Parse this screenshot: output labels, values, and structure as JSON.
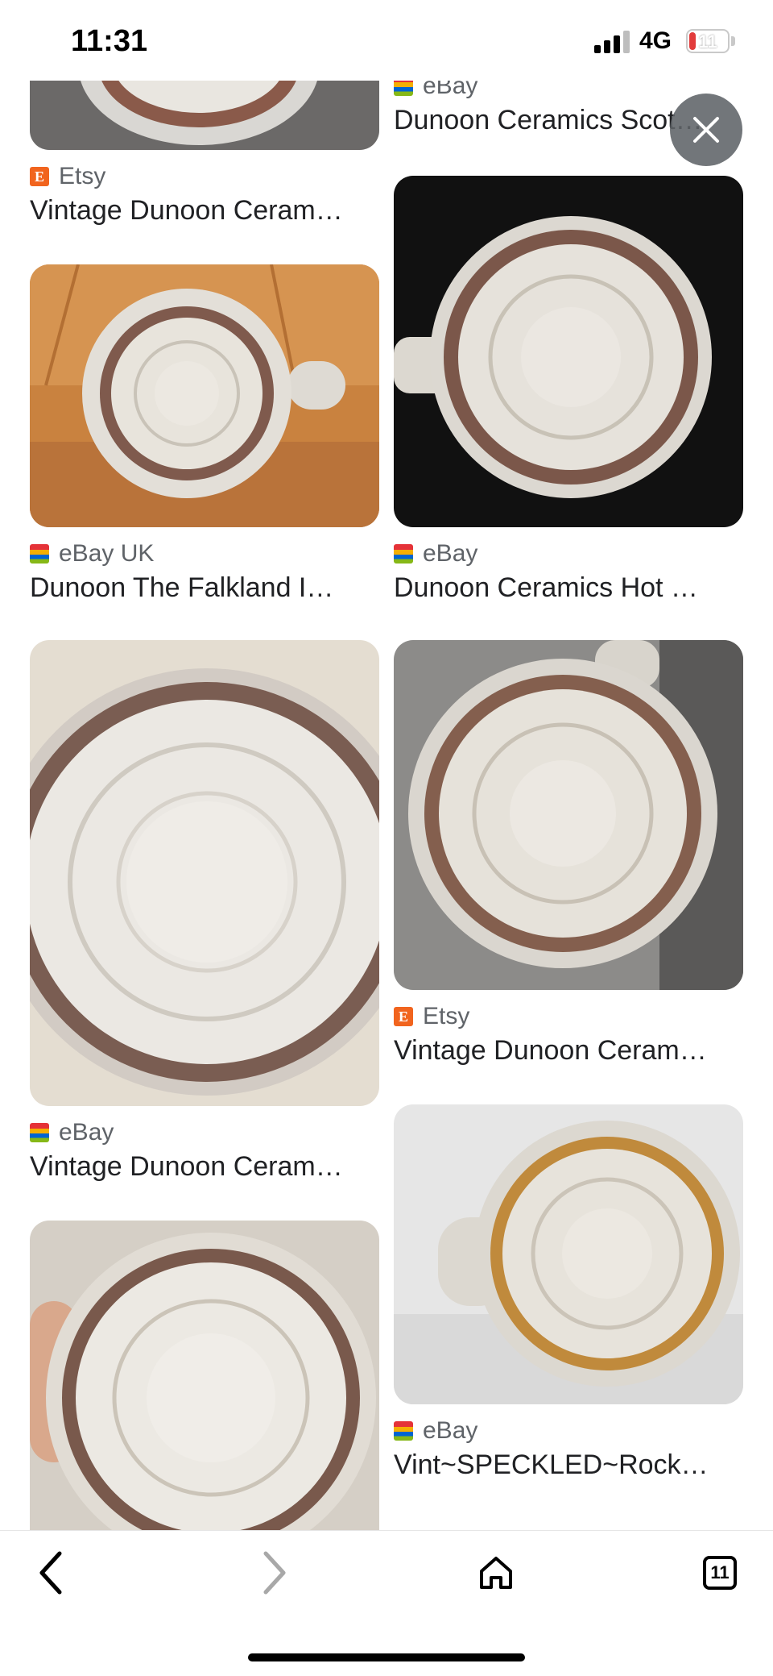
{
  "status_bar": {
    "time": "11:31",
    "network": "4G",
    "battery": "11"
  },
  "results": {
    "left": [
      {
        "source": "Etsy",
        "source_icon": "etsy-icon",
        "title": "Vintage Dunoon Ceram…"
      },
      {
        "source": "eBay UK",
        "source_icon": "ebay-icon",
        "title": "Dunoon The Falkland I…"
      },
      {
        "source": "eBay",
        "source_icon": "ebay-icon",
        "title": "Vintage Dunoon Ceram…"
      },
      {
        "source": "",
        "source_icon": "",
        "title": ""
      }
    ],
    "right": [
      {
        "source": "eBay",
        "source_icon": "ebay-icon",
        "title": "Dunoon Ceramics Scot…"
      },
      {
        "source": "eBay",
        "source_icon": "ebay-icon",
        "title": "Dunoon Ceramics Hot …"
      },
      {
        "source": "Etsy",
        "source_icon": "etsy-icon",
        "title": "Vintage Dunoon Ceram…"
      },
      {
        "source": "eBay",
        "source_icon": "ebay-icon",
        "title": "Vint~SPECKLED~Rock…"
      }
    ]
  },
  "toolbar": {
    "tab_count": "11"
  },
  "colors": {
    "etsy": "#f1641e",
    "ebay_red": "#e53238",
    "close_bg": "#5f6368"
  }
}
